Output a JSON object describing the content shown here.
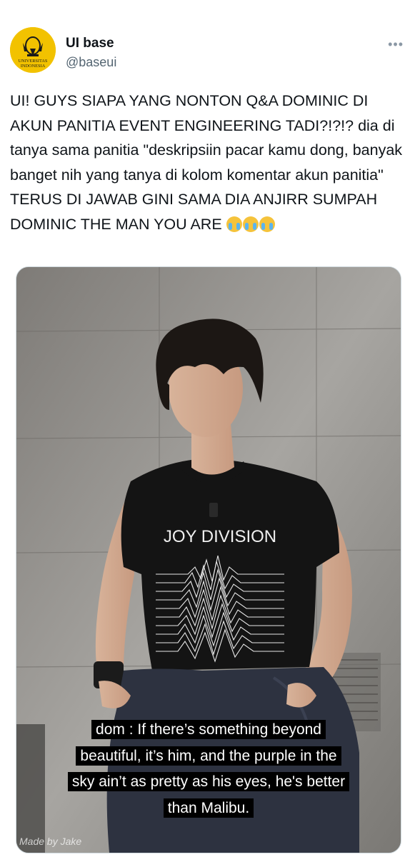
{
  "account": {
    "name": "UI base",
    "handle": "@baseui",
    "avatar_text_top": "UNIVERSITAS",
    "avatar_text_bottom": "INDONESIA"
  },
  "more_icon": "more-horizontal-icon",
  "tweet_text": "UI! GUYS SIAPA YANG NONTON Q&A DOMINIC DI AKUN PANITIA EVENT ENGINEERING TADI?!?!? dia di tanya sama panitia \"deskripsiin pacar kamu dong, banyak banget nih yang tanya di kolom komentar akun panitia\" TERUS DI JAWAB GINI SAMA DIA ANJIRR SUMPAH DOMINIC THE MAN YOU ARE ",
  "emoji": [
    "loudly-crying-face",
    "loudly-crying-face",
    "loudly-crying-face"
  ],
  "media": {
    "shirt_text": "JOY DIVISION",
    "caption_lines": [
      "dom : If there’s something beyond",
      "beautiful, it’s him, and the purple in the",
      "sky ain’t as pretty as his eyes, he's better",
      "than Malibu."
    ],
    "watermark": "Made by Jake"
  },
  "colors": {
    "avatar_bg": "#f2c200",
    "handle": "#536471",
    "text": "#0f1419"
  }
}
